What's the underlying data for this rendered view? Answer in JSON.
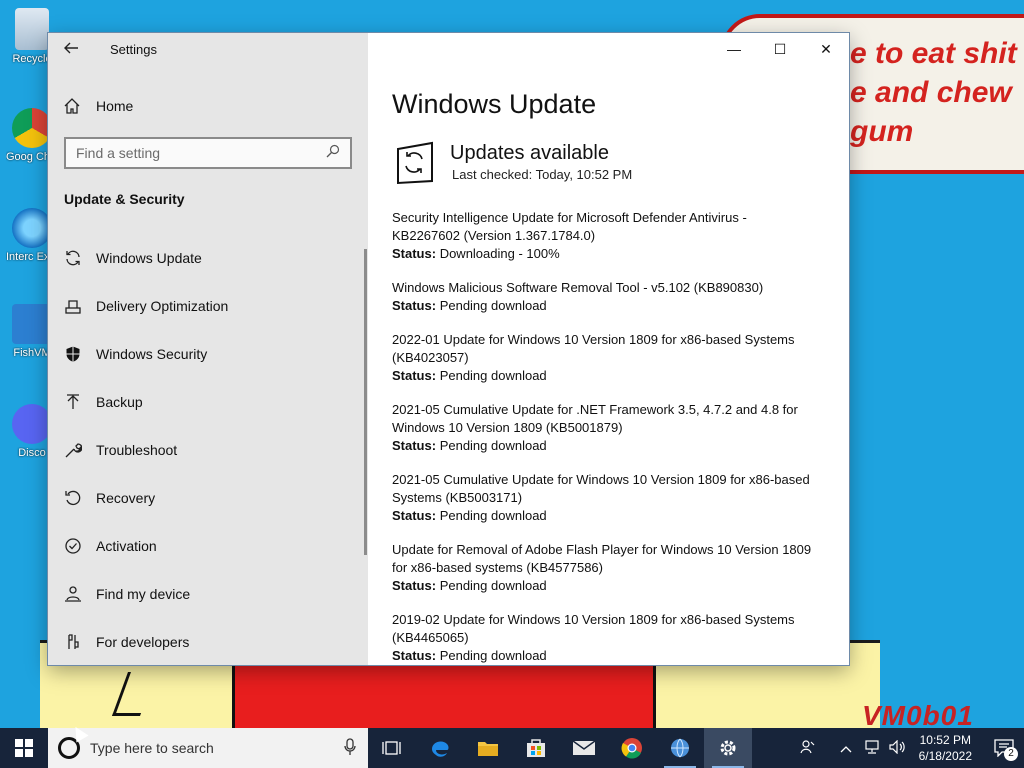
{
  "desktop": {
    "wallpaper_text": [
      "e to eat shit",
      "e and chew",
      "gum"
    ],
    "wallpaper_signature": "VM0b01",
    "icons": [
      {
        "label": "Recycle",
        "icon": "recycle-bin-icon"
      },
      {
        "label": "Goog Chro",
        "icon": "chrome-icon"
      },
      {
        "label": "Interc Explode",
        "icon": "internet-explorer-icon"
      },
      {
        "label": "FishVM",
        "icon": "fishvm-icon"
      },
      {
        "label": "Disco",
        "icon": "discord-icon"
      }
    ]
  },
  "window": {
    "app_title": "Settings",
    "controls": {
      "minimize": "—",
      "maximize": "☐",
      "close": "✕"
    },
    "sidebar": {
      "home_label": "Home",
      "search_placeholder": "Find a setting",
      "section_title": "Update & Security",
      "items": [
        {
          "label": "Windows Update",
          "icon": "refresh-icon"
        },
        {
          "label": "Delivery Optimization",
          "icon": "delivery-optimization-icon"
        },
        {
          "label": "Windows Security",
          "icon": "shield-icon"
        },
        {
          "label": "Backup",
          "icon": "backup-arrow-icon"
        },
        {
          "label": "Troubleshoot",
          "icon": "wrench-icon"
        },
        {
          "label": "Recovery",
          "icon": "recovery-icon"
        },
        {
          "label": "Activation",
          "icon": "check-circle-icon"
        },
        {
          "label": "Find my device",
          "icon": "person-location-icon"
        },
        {
          "label": "For developers",
          "icon": "developer-tools-icon"
        }
      ]
    },
    "content": {
      "page_title": "Windows Update",
      "status_title": "Updates available",
      "last_checked": "Last checked: Today, 10:52 PM",
      "status_label": "Status:",
      "updates": [
        {
          "name": "Security Intelligence Update for Microsoft Defender Antivirus - KB2267602 (Version 1.367.1784.0)",
          "status": "Downloading - 100%"
        },
        {
          "name": "Windows Malicious Software Removal Tool - v5.102 (KB890830)",
          "status": "Pending download"
        },
        {
          "name": "2022-01 Update for Windows 10 Version 1809 for x86-based Systems (KB4023057)",
          "status": "Pending download"
        },
        {
          "name": "2021-05 Cumulative Update for .NET Framework 3.5, 4.7.2 and 4.8 for Windows 10 Version 1809 (KB5001879)",
          "status": "Pending download"
        },
        {
          "name": "2021-05 Cumulative Update for Windows 10 Version 1809 for x86-based Systems (KB5003171)",
          "status": "Pending download"
        },
        {
          "name": "Update for Removal of Adobe Flash Player for Windows 10 Version 1809 for x86-based systems (KB4577586)",
          "status": "Pending download"
        },
        {
          "name": "2019-02 Update for Windows 10 Version 1809 for x86-based Systems (KB4465065)",
          "status": "Pending download"
        }
      ]
    }
  },
  "taskbar": {
    "search_placeholder": "Type here to search",
    "apps": [
      "task-view-icon",
      "edge-icon",
      "file-explorer-icon",
      "store-icon",
      "mail-icon",
      "chrome-icon",
      "network-globe-icon",
      "settings-gear-icon"
    ],
    "time": "10:52 PM",
    "date": "6/18/2022",
    "notification_count": "2"
  }
}
